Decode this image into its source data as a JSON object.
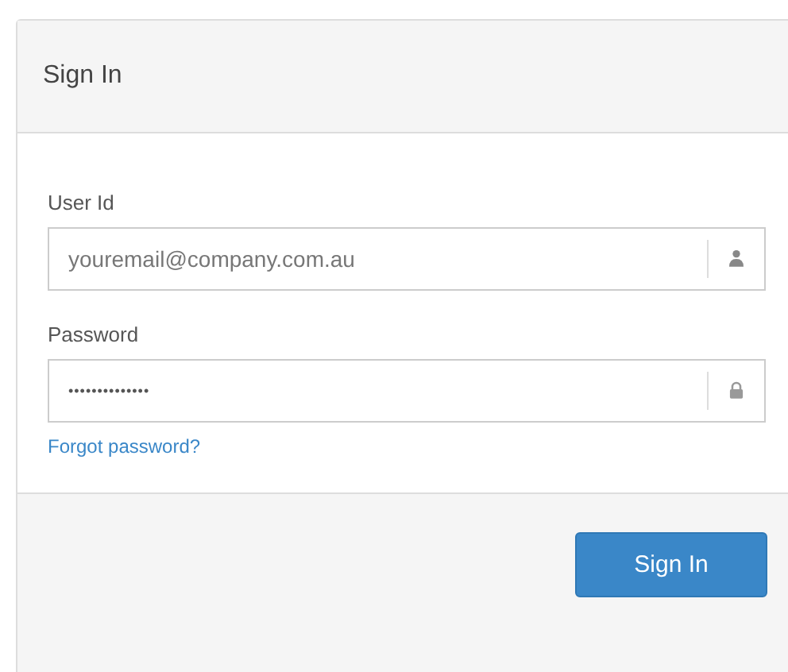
{
  "panel": {
    "title": "Sign In"
  },
  "fields": [
    {
      "label": "User Id",
      "placeholder": "youremail@company.com.au",
      "kind": "user"
    },
    {
      "label": "Password",
      "value": "••••••••••••••",
      "kind": "lock"
    }
  ],
  "forgot_link": "Forgot password?",
  "submit_button": "Sign In"
}
